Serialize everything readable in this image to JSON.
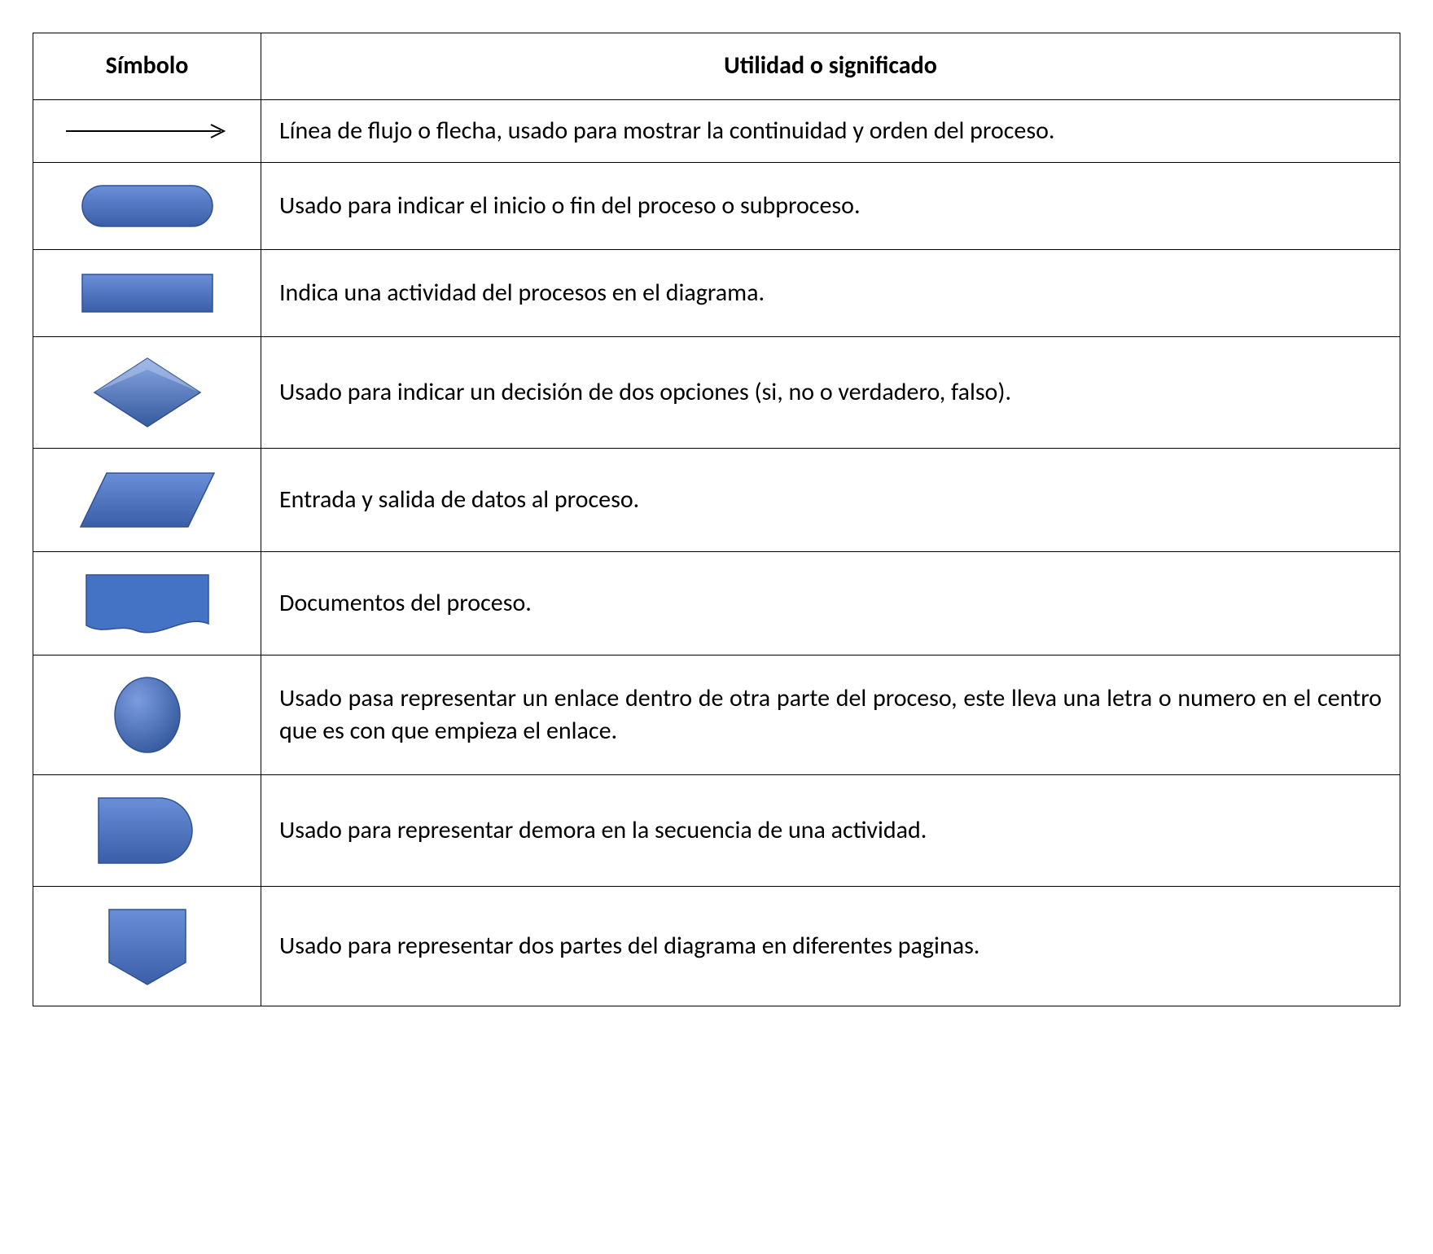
{
  "headers": {
    "symbol": "Símbolo",
    "meaning": "Utilidad o significado"
  },
  "rows": [
    {
      "icon": "arrow",
      "text": "Línea de flujo o flecha, usado para mostrar la continuidad y orden del proceso."
    },
    {
      "icon": "terminator",
      "text": "Usado para indicar el inicio o fin del proceso o subproceso."
    },
    {
      "icon": "process",
      "text": "Indica una actividad del  procesos en el diagrama."
    },
    {
      "icon": "decision",
      "text": "Usado para indicar un decisión de dos opciones (si, no o verdadero, falso)."
    },
    {
      "icon": "data",
      "text": "Entrada  y salida de datos al proceso."
    },
    {
      "icon": "document",
      "text": "Documentos  del proceso."
    },
    {
      "icon": "connector",
      "text": "Usado pasa representar un enlace dentro de otra parte del proceso, este lleva una letra o numero en el centro que es con que empieza el enlace."
    },
    {
      "icon": "delay",
      "text": "Usado para representar demora en la secuencia de una actividad."
    },
    {
      "icon": "offpage",
      "text": "Usado para representar dos partes del diagrama en diferentes paginas."
    }
  ],
  "colors": {
    "fill": "#4472c4",
    "fillLight": "#6a8fd8",
    "stroke": "#2f528f"
  }
}
